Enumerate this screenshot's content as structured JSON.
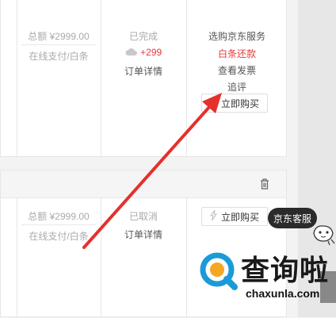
{
  "orders": [
    {
      "total": "总额 ¥2999.00",
      "payment": "在线支付/白条",
      "status": "已完成",
      "points": "+299",
      "detail_link": "订单详情",
      "actions": [
        "选购京东服务",
        "白条还款",
        "查看发票",
        "追评"
      ],
      "buy_button": "立即购买"
    },
    {
      "total": "总额 ¥2999.00",
      "payment": "在线支付/白条",
      "status": "已取消",
      "detail_link": "订单详情",
      "buy_button": "立即购买"
    }
  ],
  "customer_service": "京东客服",
  "watermark": {
    "brand": "查询啦",
    "domain": "chaxunla.com"
  },
  "colors": {
    "accent_red": "#e4393c",
    "arrow_red": "#e5302c",
    "watermark_blue": "#1a9bd7"
  }
}
